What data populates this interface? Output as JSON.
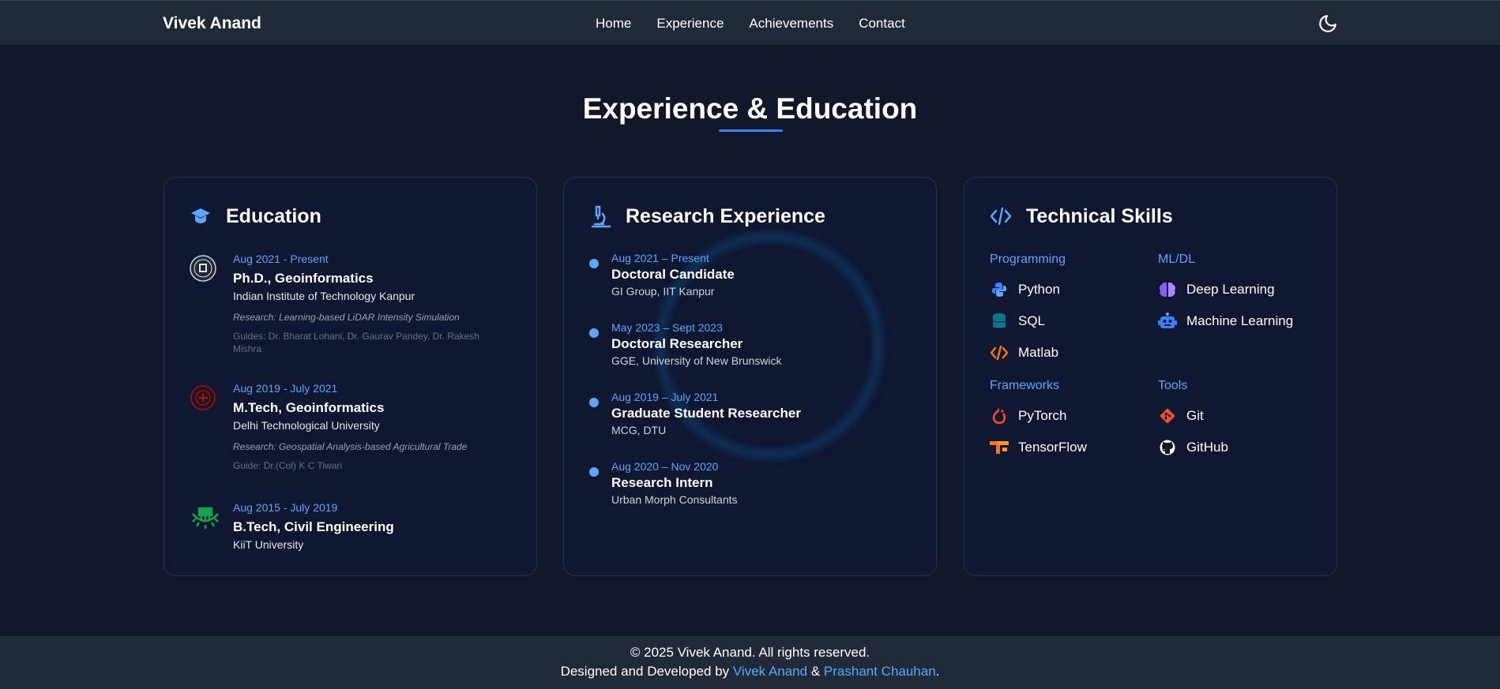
{
  "nav": {
    "brand": "Vivek Anand",
    "links": [
      {
        "label": "Home"
      },
      {
        "label": "Experience"
      },
      {
        "label": "Achievements"
      },
      {
        "label": "Contact"
      }
    ],
    "theme_icon": "moon-icon"
  },
  "section": {
    "title": "Experience & Education"
  },
  "education": {
    "title": "Education",
    "icon": "graduation-cap-icon",
    "items": [
      {
        "logo": "iit-kanpur-logo",
        "date": "Aug 2021 - Present",
        "degree": "Ph.D., Geoinformatics",
        "institution": "Indian Institute of Technology Kanpur",
        "research": "Research: Learning-based LiDAR Intensity Simulation",
        "guides": "Guides: Dr. Bharat Lohani, Dr. Gaurav Pandey, Dr. Rakesh Mishra"
      },
      {
        "logo": "dtu-logo",
        "date": "Aug 2019 - July 2021",
        "degree": "M.Tech, Geoinformatics",
        "institution": "Delhi Technological University",
        "research": "Research: Geospatial Analysis-based Agricultural Trade",
        "guides": "Guide: Dr.(Col) K C Tiwari"
      },
      {
        "logo": "kiit-logo",
        "date": "Aug 2015 - July 2019",
        "degree": "B.Tech, Civil Engineering",
        "institution": "KiiT University"
      }
    ]
  },
  "research": {
    "title": "Research Experience",
    "icon": "microscope-icon",
    "items": [
      {
        "date": "Aug 2021 – Present",
        "role": "Doctoral Candidate",
        "org": "GI Group, IIT Kanpur"
      },
      {
        "date": "May 2023 – Sept 2023",
        "role": "Doctoral Researcher",
        "org": "GGE, University of New Brunswick"
      },
      {
        "date": "Aug 2019 – July 2021",
        "role": "Graduate Student Researcher",
        "org": "MCG, DTU"
      },
      {
        "date": "Aug 2020 – Nov 2020",
        "role": "Research Intern",
        "org": "Urban Morph Consultants"
      }
    ]
  },
  "skills": {
    "title": "Technical Skills",
    "icon": "code-icon",
    "categories": {
      "programming": {
        "label": "Programming",
        "items": [
          {
            "label": "Python",
            "icon": "python-icon"
          },
          {
            "label": "SQL",
            "icon": "database-icon"
          },
          {
            "label": "Matlab",
            "icon": "code-icon"
          }
        ]
      },
      "mldl": {
        "label": "ML/DL",
        "items": [
          {
            "label": "Deep Learning",
            "icon": "brain-icon"
          },
          {
            "label": "Machine Learning",
            "icon": "robot-icon"
          }
        ]
      },
      "frameworks": {
        "label": "Frameworks",
        "items": [
          {
            "label": "PyTorch",
            "icon": "pytorch-icon"
          },
          {
            "label": "TensorFlow",
            "icon": "tensorflow-icon"
          }
        ]
      },
      "tools": {
        "label": "Tools",
        "items": [
          {
            "label": "Git",
            "icon": "git-icon"
          },
          {
            "label": "GitHub",
            "icon": "github-icon"
          }
        ]
      }
    }
  },
  "footer": {
    "copyright": "© 2025 Vivek Anand. All rights reserved.",
    "designed_prefix": "Designed and Developed by ",
    "author1": "Vivek Anand",
    "amp": " & ",
    "author2": "Prashant Chauhan",
    "suffix": "."
  },
  "colors": {
    "background": "#0f1729",
    "card": "#0e1630",
    "accent": "#60a5fa",
    "nav": "#1f2937"
  }
}
